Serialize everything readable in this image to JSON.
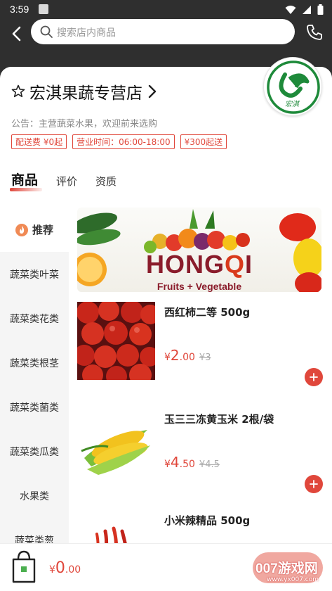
{
  "status_bar": {
    "time": "3:59"
  },
  "search": {
    "placeholder": "搜索店内商品"
  },
  "store": {
    "name": "宏淇果蔬专营店",
    "logo_text": "宏淇",
    "notice": "公告：主营蔬菜水果，欢迎前来选购",
    "tags": [
      "配送费 ¥0起",
      "营业时间：06:00-18:00",
      "¥300起送"
    ]
  },
  "tabs": [
    "商品",
    "评价",
    "资质"
  ],
  "sidebar": {
    "items": [
      "推荐",
      "蔬菜类叶菜",
      "蔬菜类花类",
      "蔬菜类根茎",
      "蔬菜类菌类",
      "蔬菜类瓜类",
      "水果类",
      "蔬菜类葱"
    ]
  },
  "banner": {
    "title_left": "HONG",
    "title_q": "Q",
    "title_i": "I",
    "subtitle": "Fruits + Vegetable"
  },
  "products": [
    {
      "name": "西红柿二等 500g",
      "currency": "¥",
      "price_int": "2",
      "price_dec": ".00",
      "original": "¥3"
    },
    {
      "name": "玉三三冻黄玉米 2根/袋",
      "currency": "¥",
      "price_int": "4",
      "price_dec": ".50",
      "original": "¥4.5"
    },
    {
      "name": "小米辣精品 500g"
    }
  ],
  "cart": {
    "currency": "¥",
    "total_int": "0",
    "total_dec": ".00"
  },
  "watermark": {
    "text": "007游戏网",
    "sub": "www.yx007.com"
  },
  "colors": {
    "accent": "#e0473b",
    "topbar": "#2f2f2f",
    "sidebar_bg": "#f5f5f5"
  }
}
